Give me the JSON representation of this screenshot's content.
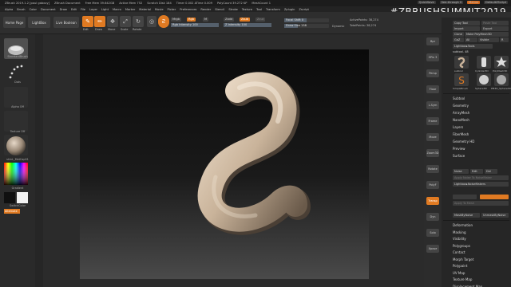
{
  "titlebar": {
    "items": [
      "ZBrush 2019.1.2 [paul gabovy]",
      "ZBrush Document",
      "Free Mem 39.642GB",
      "Active Mem 752",
      "Scratch Disk 184",
      "Timer 0.002 ATime 0.009",
      "PolyCount 39.272 KP",
      "MeshCount 1"
    ],
    "quicksave": "QuickSave",
    "see_through": "See-through 0",
    "menus": "Menus",
    "default_script": "DefaultZScript"
  },
  "menubar": {
    "items": [
      "Alpha",
      "Brush",
      "Color",
      "Document",
      "Draw",
      "Edit",
      "File",
      "Layer",
      "Light",
      "Macro",
      "Marker",
      "Material",
      "Movie",
      "Picker",
      "Preferences",
      "Render",
      "Stencil",
      "Stroke",
      "Texture",
      "Tool",
      "Transform",
      "Zplugin",
      "Zscript"
    ]
  },
  "hashtag": "#ZBRUSHSUMMIT2019",
  "toolbar": {
    "home_page": "Home Page",
    "lightbox": "LightBox",
    "live_boolean": "Live Boolean",
    "edit": "Edit",
    "draw": "Draw",
    "move": "Move",
    "scale": "Scale",
    "rotate": "Rotate",
    "mrgb": "Mrgb",
    "rgb": "Rgb",
    "m": "M",
    "zadd": "Zadd",
    "zsub": "Zsub",
    "zcut": "Zcut",
    "rgb_intensity": "Rgb Intensity 100",
    "z_intensity": "Z Intensity 100",
    "focal_shift": "Focal Shift 0",
    "draw_size": "Draw Size 158",
    "dynamic": "Dynamic",
    "active_points": "ActivePoints: 38,274",
    "total_points": "TotalPoints: 38,274"
  },
  "lefttray": {
    "brush_label": "StandardBrush",
    "stroke_label": "Dots",
    "alpha_label": "Alpha Off",
    "texture_label": "Texture Off",
    "material_label": "skinL_MatCap01",
    "gradient": "Gradient",
    "switch_color": "SwitchColor",
    "alternate": "Alternate"
  },
  "rightshelf": {
    "buttons": [
      "Bpr",
      "SPix 3",
      "Persp",
      "Floor",
      "L.Sym",
      "Frame",
      "Move",
      "Zoom3D",
      "Rotate",
      "PolyF",
      "Transp",
      "Dyn",
      "Solo",
      "Xpose"
    ]
  },
  "rightpanel": {
    "copy_tool": "Copy Tool",
    "paste_tool": "Paste Tool",
    "import": "Import",
    "export": "Export",
    "clone": "Clone",
    "make_polymesh": "Make PolyMesh3D",
    "goz": "GoZ",
    "all": "All",
    "visible": "Visible",
    "r": "R",
    "lightbox_tools": "Lightbox▸Tools",
    "tool_name": "subtool. 48",
    "thumbs": [
      "subtool",
      "Cylinder3D",
      "PolyMesh3D",
      "SimpleBrush",
      "Sphere3D",
      "PM3D_Sphere3D"
    ],
    "menus": [
      "Subtool",
      "Geometry",
      "ArrayMesh",
      "NanoMesh",
      "Layers",
      "FiberMesh",
      "Geometry HD",
      "Preview",
      "Surface"
    ],
    "noise": "Noise",
    "edit": "Edit",
    "del": "Del",
    "apply_noise": "Apply Noise To NoiseMaker",
    "lightbox_noisemakers": "Lightbox▸NoiseMakers",
    "mask_by_noise": "MaskByNoise",
    "unmask_by_noise": "UnmaskByNoise",
    "apply_surface": "Apply To Mesh",
    "menus2": [
      "Deformation",
      "Masking",
      "Visibility",
      "Polygroups",
      "Contact",
      "Morph Target",
      "Polypaint",
      "UV Map",
      "Texture Map",
      "Displacement Map"
    ]
  },
  "colors": {
    "accent": "#e07a22",
    "mesh": "#c9b39a"
  }
}
